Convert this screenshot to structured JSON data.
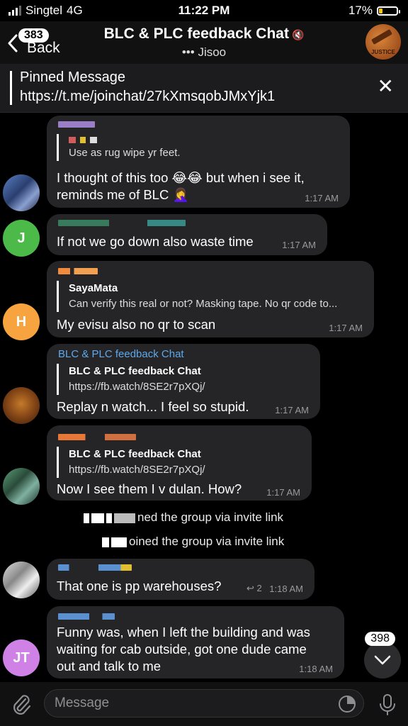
{
  "status": {
    "carrier": "Singtel",
    "network": "4G",
    "time": "11:22 PM",
    "battery": "17%",
    "battery_level": 0.17
  },
  "header": {
    "back_label": "Back",
    "back_badge": "383",
    "title": "BLC & PLC feedback Chat",
    "subtitle": "Jisoo",
    "typing_indicator": "•••",
    "avatar_caption": "JUSTICE"
  },
  "pinned": {
    "title": "Pinned Message",
    "text": "https://t.me/joinchat/27kXmsqobJMxYjk1"
  },
  "messages": [
    {
      "reply_text": "Use as rug wipe yr feet.",
      "line1": "I thought of this too 😂😂 but when i see it,",
      "line2": "reminds me of BLC 🤦‍♀️",
      "time": "1:17 AM"
    },
    {
      "text": "If not we go down also waste time",
      "time": "1:17 AM",
      "avatar": "J",
      "avatar_color": "#4cba48"
    },
    {
      "reply_name": "SayaMata",
      "reply_text": "Can verify this real or not? Masking tape. No qr code to...",
      "text": "My evisu also no qr to scan",
      "time": "1:17 AM",
      "avatar": "H",
      "avatar_color": "#f7a340"
    },
    {
      "sender": "BLC & PLC feedback Chat",
      "reply_name": "BLC & PLC feedback Chat",
      "reply_text": "https://fb.watch/8SE2r7pXQj/",
      "text": "Replay n watch... I feel so stupid.",
      "time": "1:17 AM"
    },
    {
      "reply_name": "BLC & PLC feedback Chat",
      "reply_text": "https://fb.watch/8SE2r7pXQj/",
      "text": "Now I see them I v dulan. How?",
      "time": "1:17 AM"
    },
    {
      "text": "That one is pp warehouses?",
      "time": "1:18 AM",
      "reply_count": "2"
    },
    {
      "line1": "Funny was, when I left the building and was",
      "line2": "waiting for cab outside, got one dude came",
      "line3": "out and talk to me",
      "time": "1:18 AM",
      "avatar": "JT",
      "avatar_color": "#d081e6"
    }
  ],
  "service": {
    "line1": "ned the group via invite link",
    "line2": "oined the group via invite link"
  },
  "scroll_badge": "398",
  "composer": {
    "placeholder": "Message"
  },
  "colors": {
    "bubble": "#252527",
    "link": "#5ea9ec",
    "background": "#000000"
  }
}
